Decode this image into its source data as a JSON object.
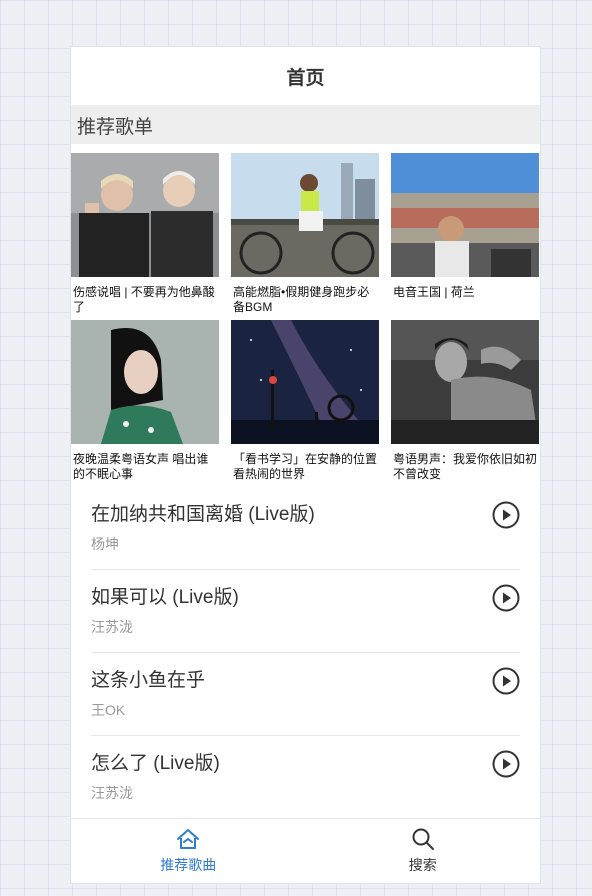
{
  "header": {
    "title": "首页"
  },
  "section": {
    "title": "推荐歌单"
  },
  "playlists": [
    {
      "caption": "伤感说唱 | 不要再为他鼻酸了"
    },
    {
      "caption": "高能燃脂•假期健身跑步必备BGM"
    },
    {
      "caption": "电音王国 | 荷兰"
    },
    {
      "caption": "夜晚温柔粤语女声 唱出谁的不眠心事"
    },
    {
      "caption": "「看书学习」在安静的位置看热闹的世界"
    },
    {
      "caption": "粤语男声：我爱你依旧如初不曾改变"
    }
  ],
  "songs": [
    {
      "name": "在加纳共和国离婚 (Live版)",
      "artist": "杨坤"
    },
    {
      "name": "如果可以 (Live版)",
      "artist": "汪苏泷"
    },
    {
      "name": "这条小鱼在乎",
      "artist": "王OK"
    },
    {
      "name": "怎么了 (Live版)",
      "artist": "汪苏泷"
    }
  ],
  "tabbar": {
    "home": {
      "label": "推荐歌曲",
      "icon": "home-icon"
    },
    "search": {
      "label": "搜索",
      "icon": "search-icon"
    }
  },
  "colors": {
    "accent": "#2d7dd2",
    "text": "#333333",
    "muted": "#999999"
  }
}
